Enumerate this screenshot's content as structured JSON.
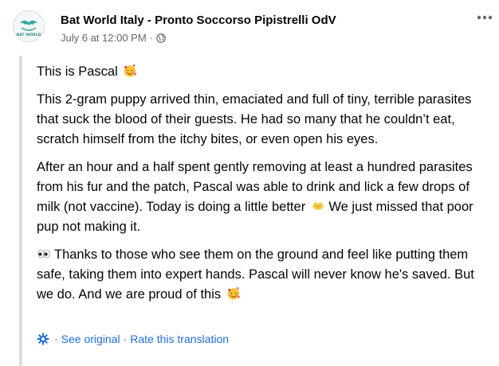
{
  "post": {
    "page_name": "Bat World Italy - Pronto Soccorso Pipistrelli OdV",
    "timestamp": "July 6 at 12:00 PM",
    "dot": "·",
    "avatar_text": "BAT WORLD",
    "paragraphs": {
      "p1": "This is Pascal",
      "p2": "This 2-gram puppy arrived thin, emaciated and full of tiny, terrible parasites that suck the blood of their guests. He had so many that he couldn’t eat, scratch himself from the itchy bites, or even open his eyes.",
      "p3_a": "After an hour and a half spent gently removing at least a hundred parasites from his fur and the patch, Pascal was able to drink and lick a few drops of milk (not vaccine). Today is doing a little better",
      "p3_b": "We just missed that poor pup not making it.",
      "p4_a": "Thanks to those who see them on the ground and feel like putting them safe, taking them into expert hands. Pascal will never know he's saved. But we do. And we are proud of this"
    },
    "translation": {
      "see_original": "See original",
      "separator": "·",
      "rate": "Rate this translation"
    }
  },
  "icons": {
    "globe": "globe-icon",
    "more": "more-options-icon",
    "gear": "translation-gear-icon",
    "smiling_hearts": "smiling-face-with-hearts-emoji",
    "heart_hands": "heart-hands-emoji",
    "eyes": "eyes-emoji"
  },
  "colors": {
    "link": "#216fdb",
    "secondary_text": "#65676b",
    "quote_bar": "#dadde1",
    "avatar_accent": "#3aa7a3"
  }
}
